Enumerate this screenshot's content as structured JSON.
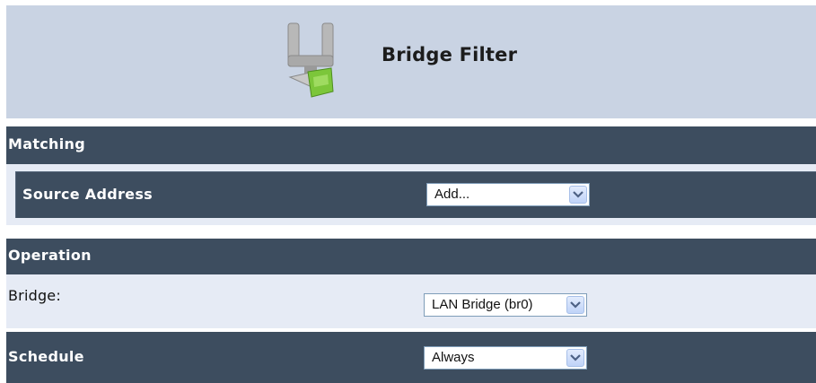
{
  "header": {
    "title": "Bridge Filter",
    "icon": "bridge-filter-icon"
  },
  "matching": {
    "heading": "Matching",
    "source_address": {
      "label": "Source Address",
      "selected": "Add..."
    }
  },
  "operation": {
    "heading": "Operation",
    "bridge": {
      "label": "Bridge:",
      "selected": "LAN Bridge (br0)"
    },
    "schedule": {
      "label": "Schedule",
      "selected": "Always"
    }
  },
  "colors": {
    "header_bg": "#c9d3e3",
    "band_bg": "#3d4d5f",
    "light_row_bg": "#e6ebf5",
    "select_arrow": "#4d6185"
  }
}
